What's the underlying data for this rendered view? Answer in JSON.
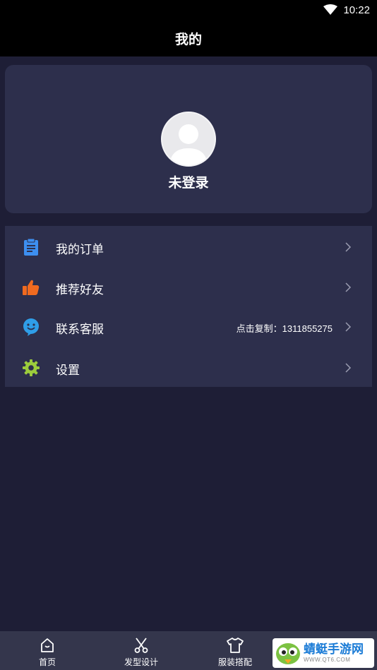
{
  "status_bar": {
    "time": "10:22"
  },
  "header": {
    "title": "我的"
  },
  "profile": {
    "login_status": "未登录"
  },
  "menu": {
    "items": [
      {
        "label": "我的订单",
        "icon": "order-icon",
        "color": "#3d8ff0",
        "extra": ""
      },
      {
        "label": "推荐好友",
        "icon": "thumbs-up-icon",
        "color": "#f06a1f",
        "extra": ""
      },
      {
        "label": "联系客服",
        "icon": "customer-service-icon",
        "color": "#2f9ee8",
        "extra": "点击复制：1311855275"
      },
      {
        "label": "设置",
        "icon": "settings-icon",
        "color": "#9ccc3c",
        "extra": ""
      }
    ]
  },
  "tab_bar": {
    "tabs": [
      {
        "label": "首页",
        "icon": "home-icon"
      },
      {
        "label": "发型设计",
        "icon": "scissors-icon"
      },
      {
        "label": "服装搭配",
        "icon": "shirt-icon"
      },
      {
        "label": "",
        "icon": "mine-icon"
      }
    ]
  },
  "watermark": {
    "brand": "蜻蜓手游网",
    "sub": "WWW.QT6.COM"
  },
  "colors": {
    "background": "#1e1e36",
    "card": "#2d2f4c",
    "header": "#000000",
    "tab_bar": "#34364c"
  }
}
